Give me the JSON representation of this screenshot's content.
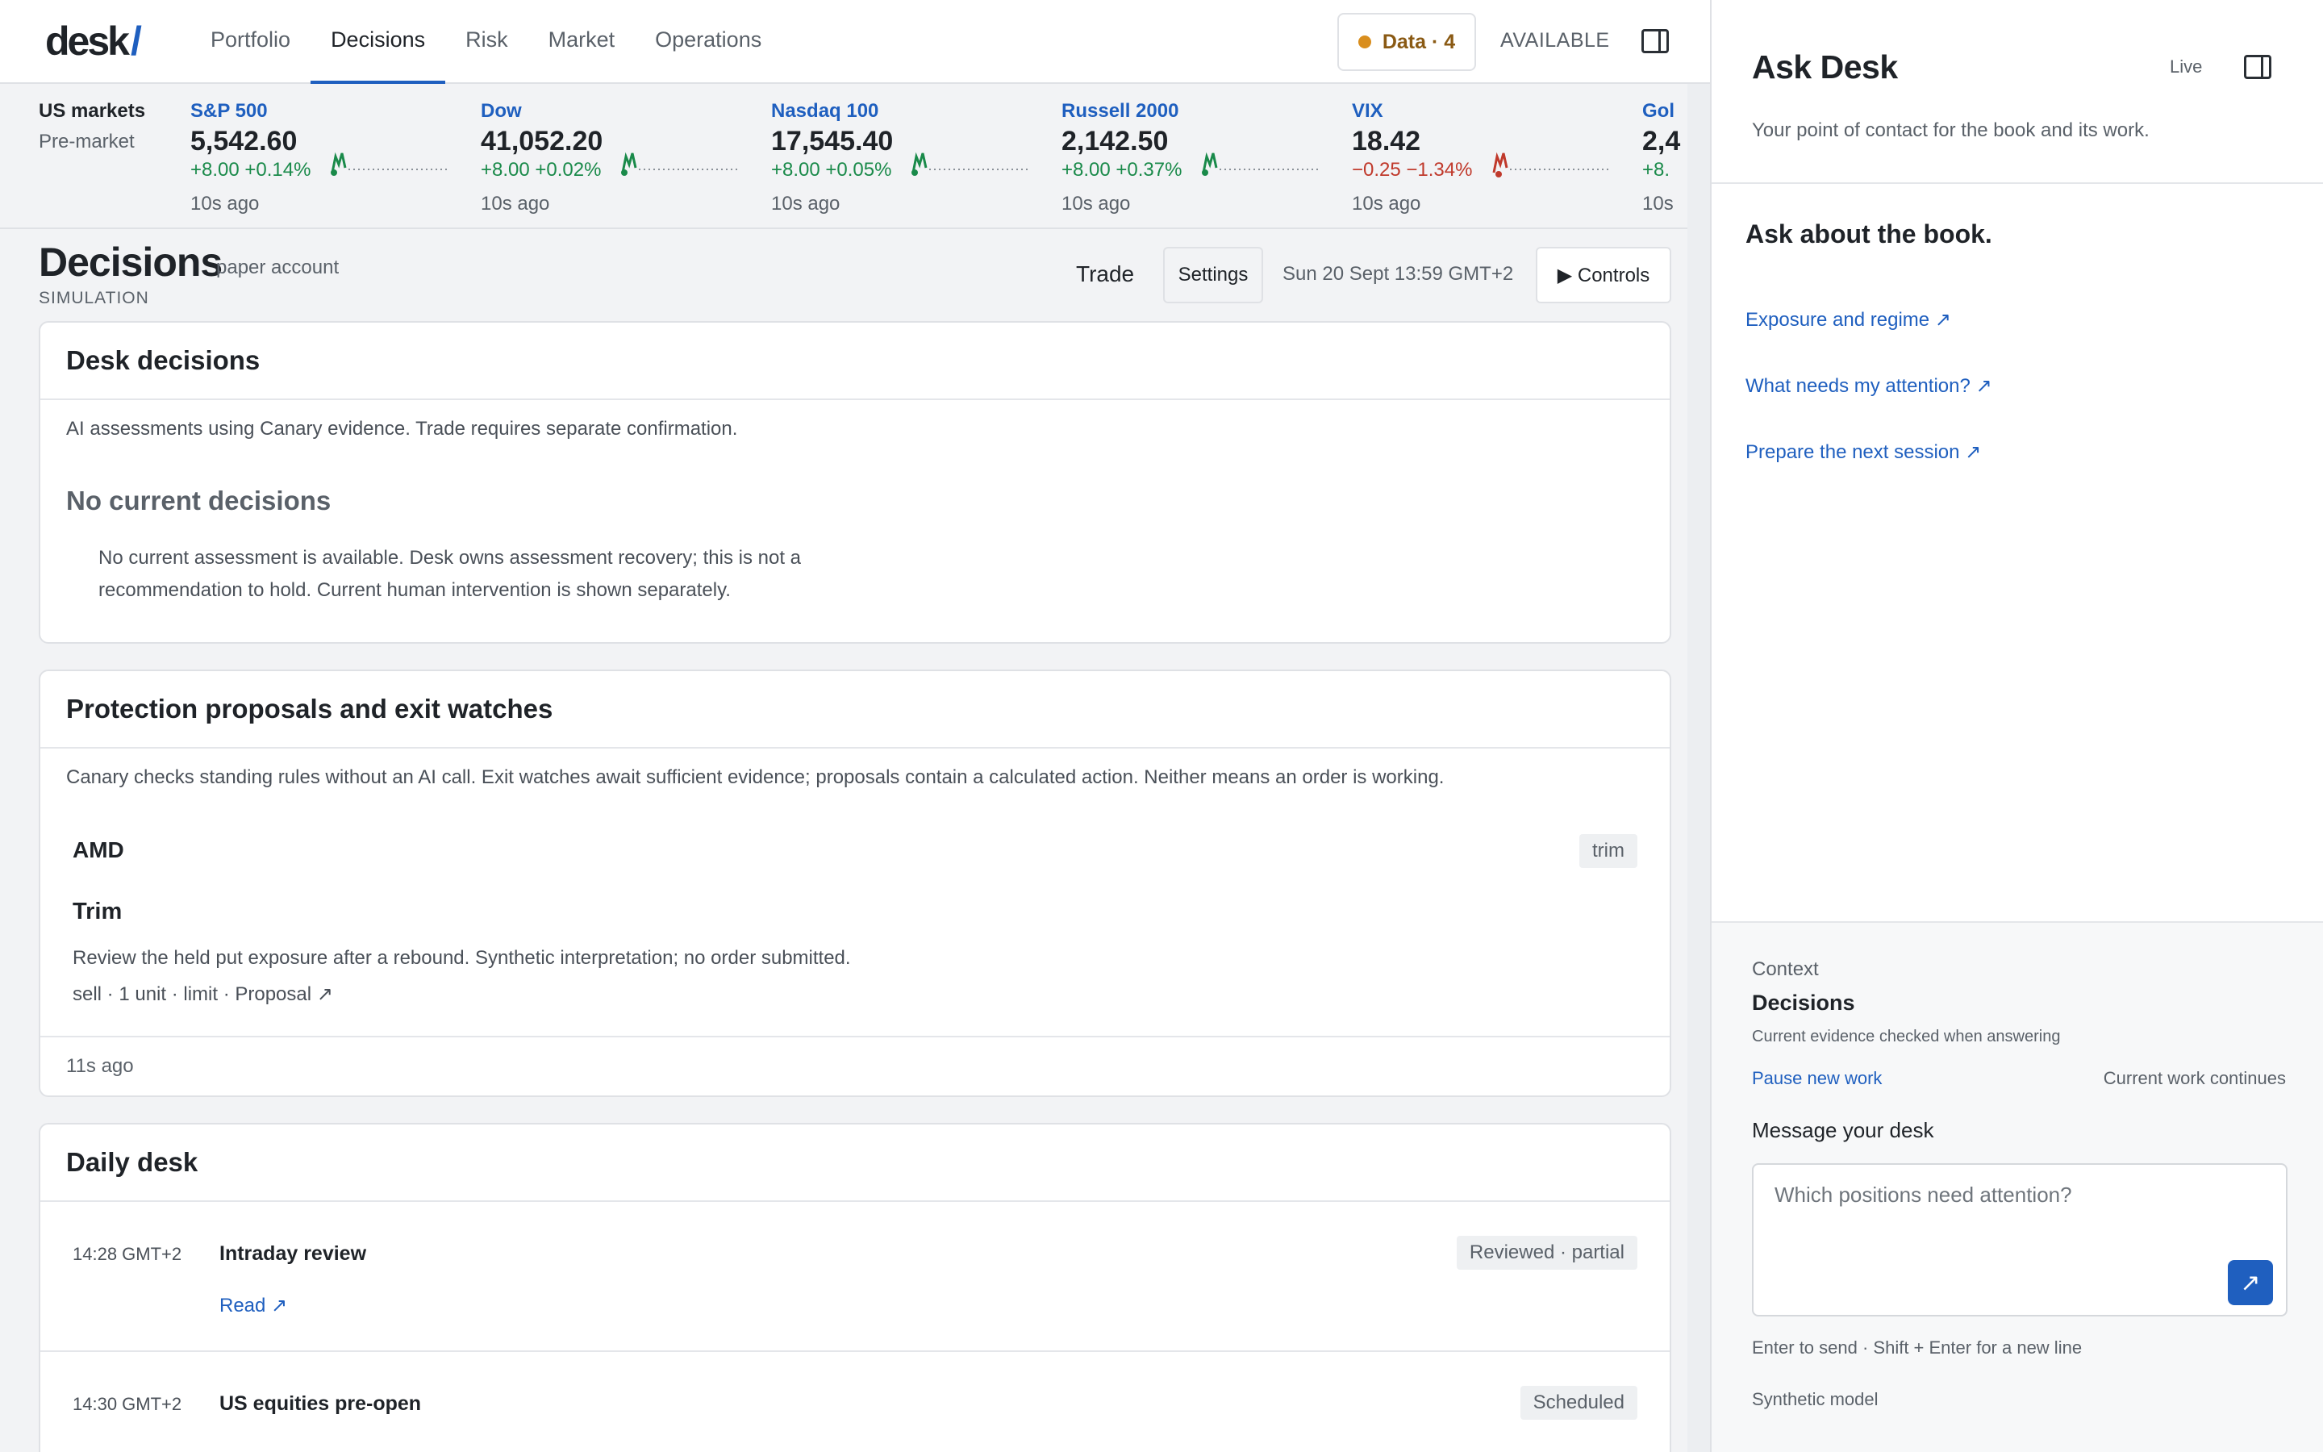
{
  "app": {
    "logo_text": "desk",
    "logo_slash": "/"
  },
  "nav": {
    "items": [
      {
        "label": "Portfolio",
        "active": false
      },
      {
        "label": "Decisions",
        "active": true
      },
      {
        "label": "Risk",
        "active": false
      },
      {
        "label": "Market",
        "active": false
      },
      {
        "label": "Operations",
        "active": false
      }
    ],
    "data_chip": "Data · 4",
    "status": "AVAILABLE"
  },
  "markets": {
    "title": "US markets",
    "session": "Pre-market",
    "tickers": [
      {
        "name": "S&P 500",
        "price": "5,542.60",
        "change": "+8.00 +0.14%",
        "ago": "10s ago",
        "direction": "up"
      },
      {
        "name": "Dow",
        "price": "41,052.20",
        "change": "+8.00 +0.02%",
        "ago": "10s ago",
        "direction": "up"
      },
      {
        "name": "Nasdaq 100",
        "price": "17,545.40",
        "change": "+8.00 +0.05%",
        "ago": "10s ago",
        "direction": "up"
      },
      {
        "name": "Russell 2000",
        "price": "2,142.50",
        "change": "+8.00 +0.37%",
        "ago": "10s ago",
        "direction": "up"
      },
      {
        "name": "VIX",
        "price": "18.42",
        "change": "−0.25 −1.34%",
        "ago": "10s ago",
        "direction": "down"
      },
      {
        "name": "Gol",
        "price": "2,4",
        "change": "+8.",
        "ago": "10s",
        "direction": "up"
      }
    ]
  },
  "page": {
    "title": "Decisions",
    "subtitle": "paper account",
    "mode": "SIMULATION",
    "trade_label": "Trade",
    "settings_label": "Settings",
    "clock": "Sun 20 Sept 13:59 GMT+2",
    "controls_label": "▶ Controls"
  },
  "desk_decisions": {
    "title": "Desk decisions",
    "description": "AI assessments using Canary evidence. Trade requires separate confirmation.",
    "empty_heading": "No current decisions",
    "empty_body": "No current assessment is available. Desk owns assessment recovery; this is not a recommendation to hold. Current human intervention is shown separately."
  },
  "protection": {
    "title": "Protection proposals and exit watches",
    "description": "Canary checks standing rules without an AI call. Exit watches await sufficient evidence; proposals contain a calculated action. Neither means an order is working.",
    "proposal": {
      "symbol": "AMD",
      "tag": "trim",
      "action": "Trim",
      "detail": "Review the held put exposure after a rebound. Synthetic interpretation; no order submitted.",
      "meta": "sell · 1 unit · limit · Proposal ↗"
    },
    "footer": "11s ago"
  },
  "daily": {
    "title": "Daily desk",
    "rows": [
      {
        "time": "14:28 GMT+2",
        "name": "Intraday review",
        "status": "Reviewed · partial",
        "link": "Read ↗"
      },
      {
        "time": "14:30 GMT+2",
        "name": "US equities pre-open",
        "status": "Scheduled",
        "link": ""
      }
    ]
  },
  "ask": {
    "title": "Ask Desk",
    "live": "Live",
    "subtitle": "Your point of contact for the book and its work.",
    "heading": "Ask about the book.",
    "links": [
      "Exposure and regime ↗",
      "What needs my attention? ↗",
      "Prepare the next session ↗"
    ],
    "context_label": "Context",
    "context_title": "Decisions",
    "context_note": "Current evidence checked when answering",
    "pause_label": "Pause new work",
    "continues_label": "Current work continues",
    "message_label": "Message your desk",
    "message_placeholder": "Which positions need attention?",
    "send_icon": "↗",
    "hint": "Enter to send · Shift + Enter for a new line",
    "model": "Synthetic model"
  },
  "colors": {
    "accent": "#1f5fbf",
    "positive": "#1a8a4a",
    "negative": "#c0392b",
    "warning": "#d98e1e"
  }
}
